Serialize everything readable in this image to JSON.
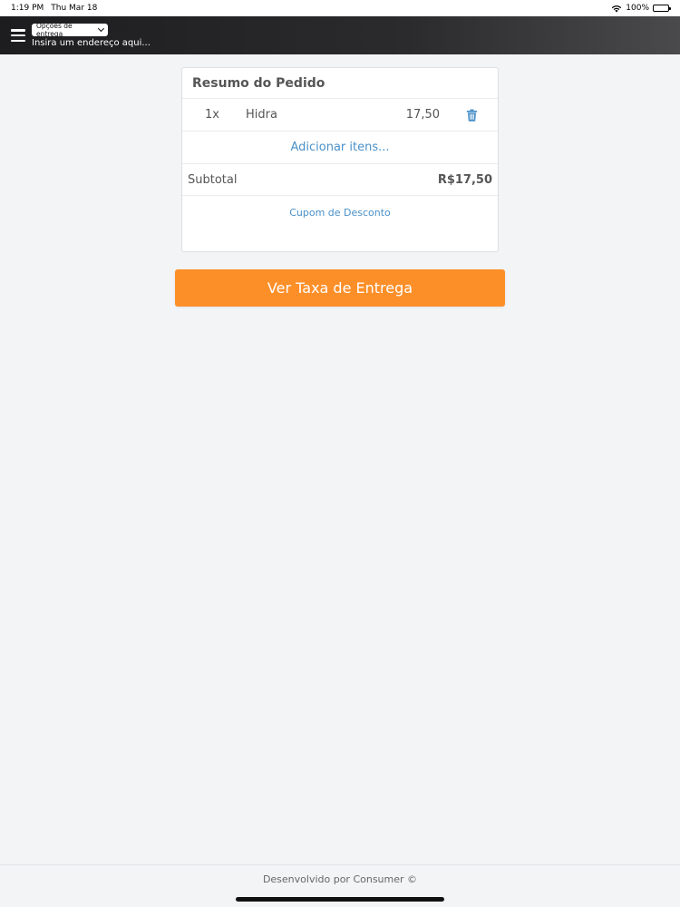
{
  "status_bar": {
    "time": "1:19 PM",
    "date": "Thu Mar 18",
    "battery": "100%"
  },
  "header": {
    "delivery_options_label": "Opções de entrega",
    "address_placeholder": "Insira um endereço aqui..."
  },
  "order_summary": {
    "title": "Resumo do Pedido",
    "items": [
      {
        "qty": "1x",
        "name": "Hidra",
        "price": "17,50"
      }
    ],
    "add_items_label": "Adicionar itens...",
    "subtotal_label": "Subtotal",
    "subtotal_value": "R$17,50",
    "coupon_label": "Cupom de Desconto"
  },
  "cta": {
    "label": "Ver Taxa de Entrega",
    "color": "#fd8f29"
  },
  "footer": {
    "text": "Desenvolvido por Consumer ©"
  },
  "colors": {
    "link": "#4a90c8",
    "header_dark": "#1d1d1f"
  }
}
